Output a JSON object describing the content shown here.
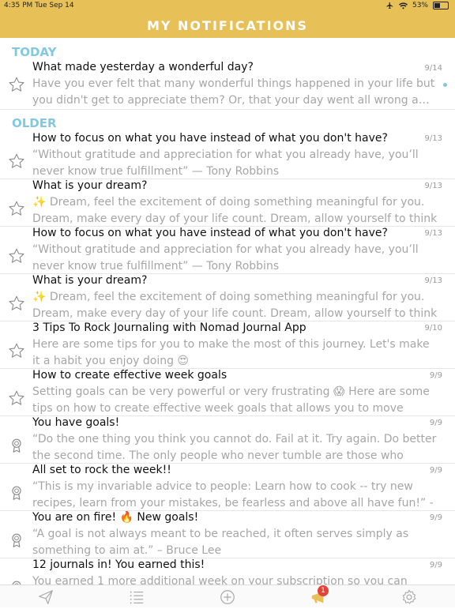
{
  "status_bar": {
    "time_date": "4:35 PM  Tue Sep 14",
    "battery": "53%",
    "battery_level": 0.53
  },
  "header": {
    "title": "MY NOTIFICATIONS"
  },
  "sections": {
    "today": "TODAY",
    "older": "OLDER"
  },
  "notifications": [
    {
      "title": "What made yesterday a wonderful day?",
      "date": "9/14",
      "body": "Have you ever felt that many wonderful things happened in your life but you didn't get to appreciate them? Or, that your day went all wrong a…",
      "icon": "star-icon",
      "unread": true
    },
    {
      "title": "How to focus on what you have instead of what you don't have?",
      "date": "9/13",
      "body": "“Without gratitude and appreciation for what you already have, you’ll never know true fulfillment” — Tony Robbins",
      "icon": "star-icon"
    },
    {
      "title": "What is your dream?",
      "date": "9/13",
      "body": "✨ Dream, feel the excitement of doing something meaningful for you. Dream, make every day of your life count. Dream, allow yourself to think th…",
      "icon": "star-icon"
    },
    {
      "title": "How to focus on what you have instead of what you don't have?",
      "date": "9/13",
      "body": "“Without gratitude and appreciation for what you already have, you’ll never know true fulfillment” — Tony Robbins",
      "icon": "star-icon"
    },
    {
      "title": "What is your dream?",
      "date": "9/13",
      "body": "✨ Dream, feel the excitement of doing something meaningful for you. Dream, make every day of your life count. Dream, allow yourself to think th…",
      "icon": "star-icon"
    },
    {
      "title": "3 Tips To Rock Journaling with Nomad Journal App",
      "date": "9/10",
      "body": "Here are some tips for you to make the most of this journey. Let's make it a habit you enjoy doing 😍",
      "icon": "star-icon"
    },
    {
      "title": "How to create effective week goals",
      "date": "9/9",
      "body": "Setting goals can be very powerful or very frustrating 😱 Here are some tips on how to create effective week goals that allows you to move forward an…",
      "icon": "star-icon"
    },
    {
      "title": "You have goals!",
      "date": "9/9",
      "body": "“Do the one thing you think you cannot do. Fail at it. Try again. Do better the second time. The only people who never tumble are those who never…",
      "icon": "medal-icon"
    },
    {
      "title": "All set to rock the week!!",
      "date": "9/9",
      "body": "“This is my invariable advice to people: Learn how to cook -- try new recipes, learn from your mistakes, be fearless and above all have fun!” - Julia Child",
      "icon": "medal-icon"
    },
    {
      "title": "You are on fire! 🔥 New goals!",
      "date": "9/9",
      "body": "“A goal is not always meant to be reached, it often serves simply as something to aim at.” – Bruce Lee",
      "icon": "medal-icon"
    },
    {
      "title": "12 journals in! You earned this!",
      "date": "9/9",
      "body": "You earned 1 more additional week on your subscription so you can continue",
      "icon": "medal-icon"
    }
  ],
  "tab_bar": {
    "items": [
      {
        "name": "paper-plane-icon"
      },
      {
        "name": "list-icon"
      },
      {
        "name": "add-circle-icon"
      },
      {
        "name": "megaphone-icon"
      },
      {
        "name": "gear-icon"
      }
    ],
    "badge": "1"
  }
}
